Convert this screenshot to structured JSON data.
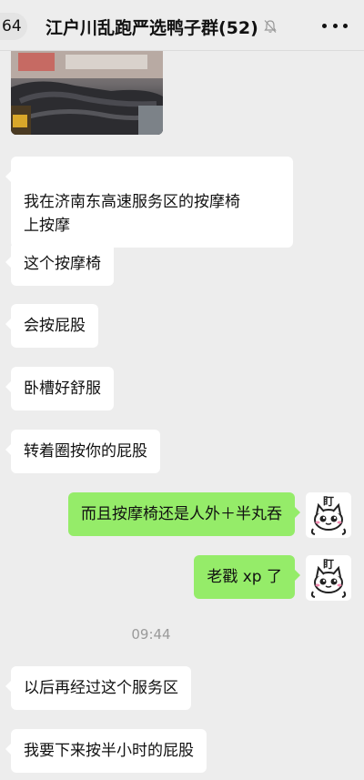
{
  "header": {
    "back_count": "64",
    "title": "江户川乱跑严选鸭子群(52)",
    "mute_icon": "bell-slash-icon",
    "more_icon": "more-dots-icon"
  },
  "photo": {
    "icon": "massage-chair-photo"
  },
  "messages": [
    {
      "side": "left",
      "text": "我在济南东高速服务区的按摩椅\n上按摩"
    },
    {
      "side": "left",
      "text": "这个按摩椅"
    },
    {
      "side": "left",
      "text": "会按屁股"
    },
    {
      "side": "left",
      "text": "卧槽好舒服"
    },
    {
      "side": "left",
      "text": "转着圈按你的屁股"
    },
    {
      "side": "right",
      "text": "而且按摩椅还是人外＋半丸吞",
      "avatar_text": "盯"
    },
    {
      "side": "right",
      "text": "老戳 xp 了",
      "avatar_text": "盯"
    },
    {
      "side": "left",
      "text": "以后再经过这个服务区"
    },
    {
      "side": "left",
      "text": "我要下来按半小时的屁股"
    }
  ],
  "timestamp": "09:44",
  "colors": {
    "background": "#ededed",
    "sent_bubble": "#95ec69",
    "received_bubble": "#ffffff"
  }
}
